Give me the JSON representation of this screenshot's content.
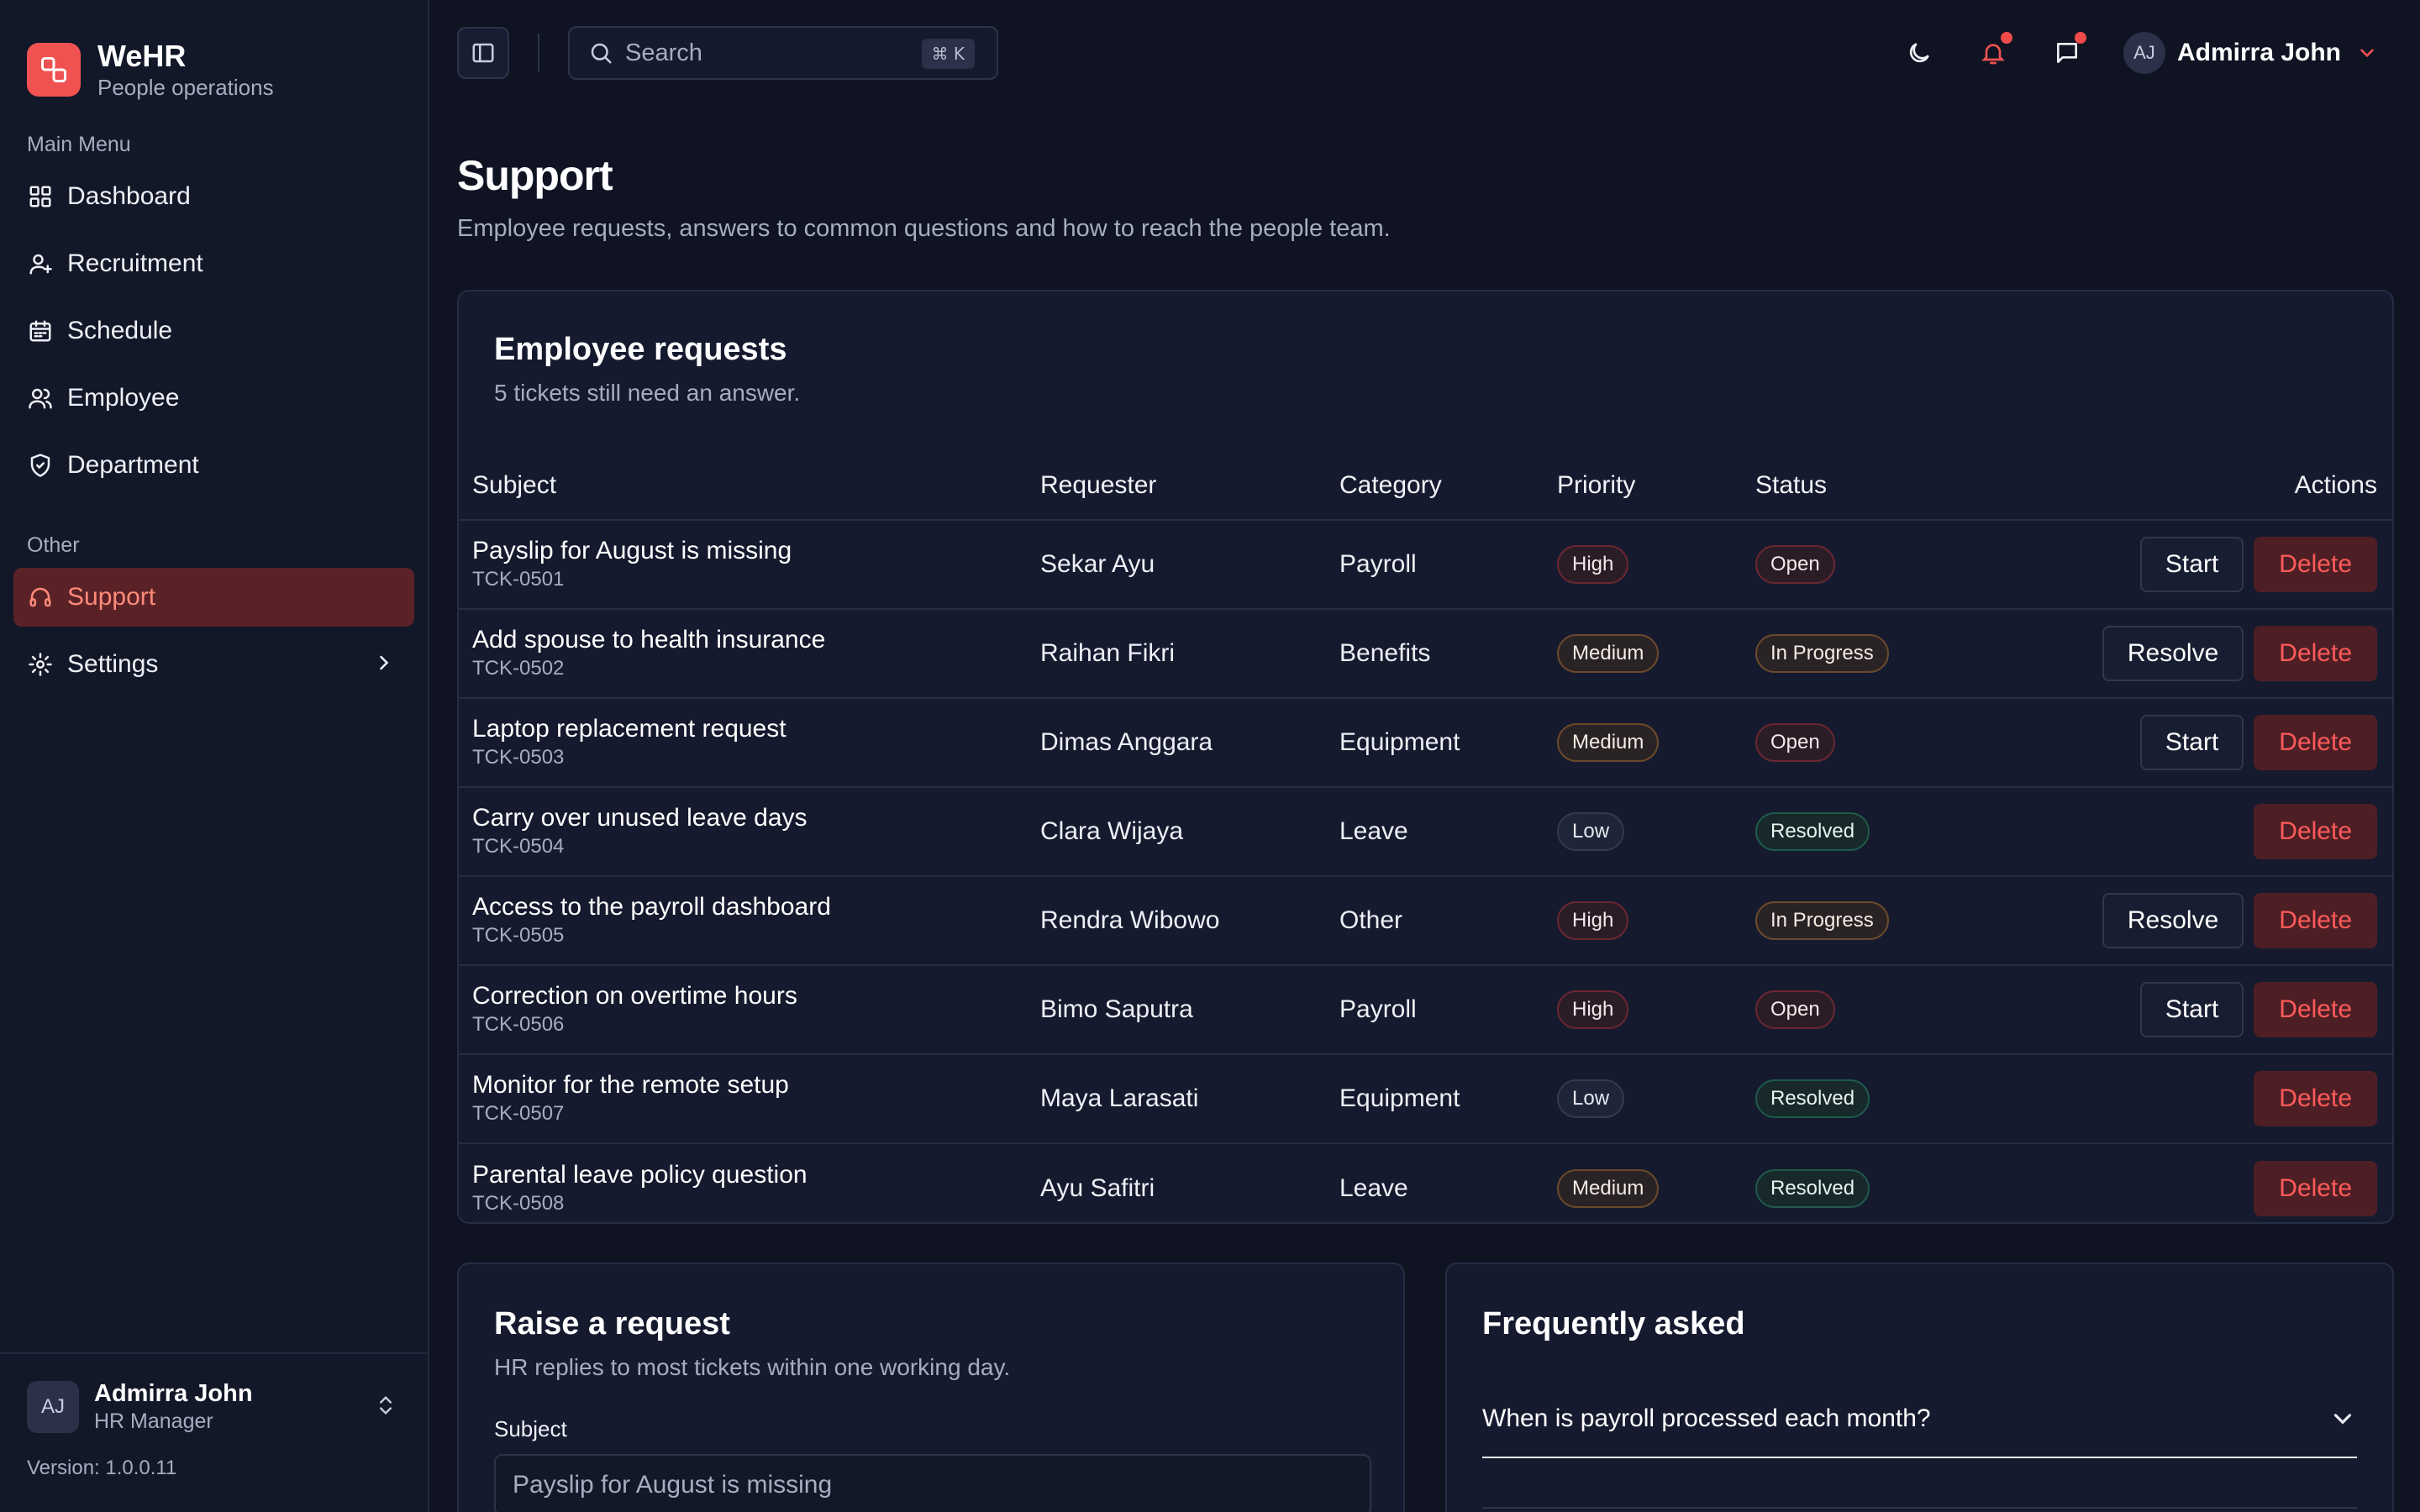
{
  "brand": {
    "name": "WeHR",
    "subtitle": "People operations"
  },
  "sidebar": {
    "main_label": "Main Menu",
    "main_items": [
      {
        "label": "Dashboard",
        "icon": "grid-icon"
      },
      {
        "label": "Recruitment",
        "icon": "user-plus-icon"
      },
      {
        "label": "Schedule",
        "icon": "calendar-icon"
      },
      {
        "label": "Employee",
        "icon": "users-icon"
      },
      {
        "label": "Department",
        "icon": "shield-icon"
      }
    ],
    "other_label": "Other",
    "other_items": [
      {
        "label": "Support",
        "icon": "headset-icon",
        "active": true
      },
      {
        "label": "Settings",
        "icon": "gear-icon"
      }
    ],
    "user": {
      "initials": "AJ",
      "name": "Admirra John",
      "role": "HR Manager"
    },
    "version": "Version: 1.0.0.11"
  },
  "topbar": {
    "search_placeholder": "Search",
    "shortcut": "⌘ K",
    "user": {
      "initials": "AJ",
      "name": "Admirra John"
    }
  },
  "page": {
    "title": "Support",
    "subtitle": "Employee requests, answers to common questions and how to reach the people team."
  },
  "requests": {
    "title": "Employee requests",
    "subtitle": "5 tickets still need an answer.",
    "columns": [
      "Subject",
      "Requester",
      "Category",
      "Priority",
      "Status",
      "Actions"
    ],
    "rows": [
      {
        "subject": "Payslip for August is missing",
        "id": "TCK-0501",
        "requester": "Sekar Ayu",
        "category": "Payroll",
        "priority": "High",
        "status": "Open",
        "action": "Start"
      },
      {
        "subject": "Add spouse to health insurance",
        "id": "TCK-0502",
        "requester": "Raihan Fikri",
        "category": "Benefits",
        "priority": "Medium",
        "status": "In Progress",
        "action": "Resolve"
      },
      {
        "subject": "Laptop replacement request",
        "id": "TCK-0503",
        "requester": "Dimas Anggara",
        "category": "Equipment",
        "priority": "Medium",
        "status": "Open",
        "action": "Start"
      },
      {
        "subject": "Carry over unused leave days",
        "id": "TCK-0504",
        "requester": "Clara Wijaya",
        "category": "Leave",
        "priority": "Low",
        "status": "Resolved",
        "action": ""
      },
      {
        "subject": "Access to the payroll dashboard",
        "id": "TCK-0505",
        "requester": "Rendra Wibowo",
        "category": "Other",
        "priority": "High",
        "status": "In Progress",
        "action": "Resolve"
      },
      {
        "subject": "Correction on overtime hours",
        "id": "TCK-0506",
        "requester": "Bimo Saputra",
        "category": "Payroll",
        "priority": "High",
        "status": "Open",
        "action": "Start"
      },
      {
        "subject": "Monitor for the remote setup",
        "id": "TCK-0507",
        "requester": "Maya Larasati",
        "category": "Equipment",
        "priority": "Low",
        "status": "Resolved",
        "action": ""
      },
      {
        "subject": "Parental leave policy question",
        "id": "TCK-0508",
        "requester": "Ayu Safitri",
        "category": "Leave",
        "priority": "Medium",
        "status": "Resolved",
        "action": ""
      }
    ],
    "delete_label": "Delete"
  },
  "raise": {
    "title": "Raise a request",
    "subtitle": "HR replies to most tickets within one working day.",
    "subject_label": "Subject",
    "subject_placeholder": "Payslip for August is missing"
  },
  "faq": {
    "title": "Frequently asked",
    "items": [
      "When is payroll processed each month?"
    ]
  },
  "colors": {
    "accent": "#f05252",
    "background": "#0f1322",
    "sidebar": "#131829",
    "danger": "#ff5a5a"
  }
}
